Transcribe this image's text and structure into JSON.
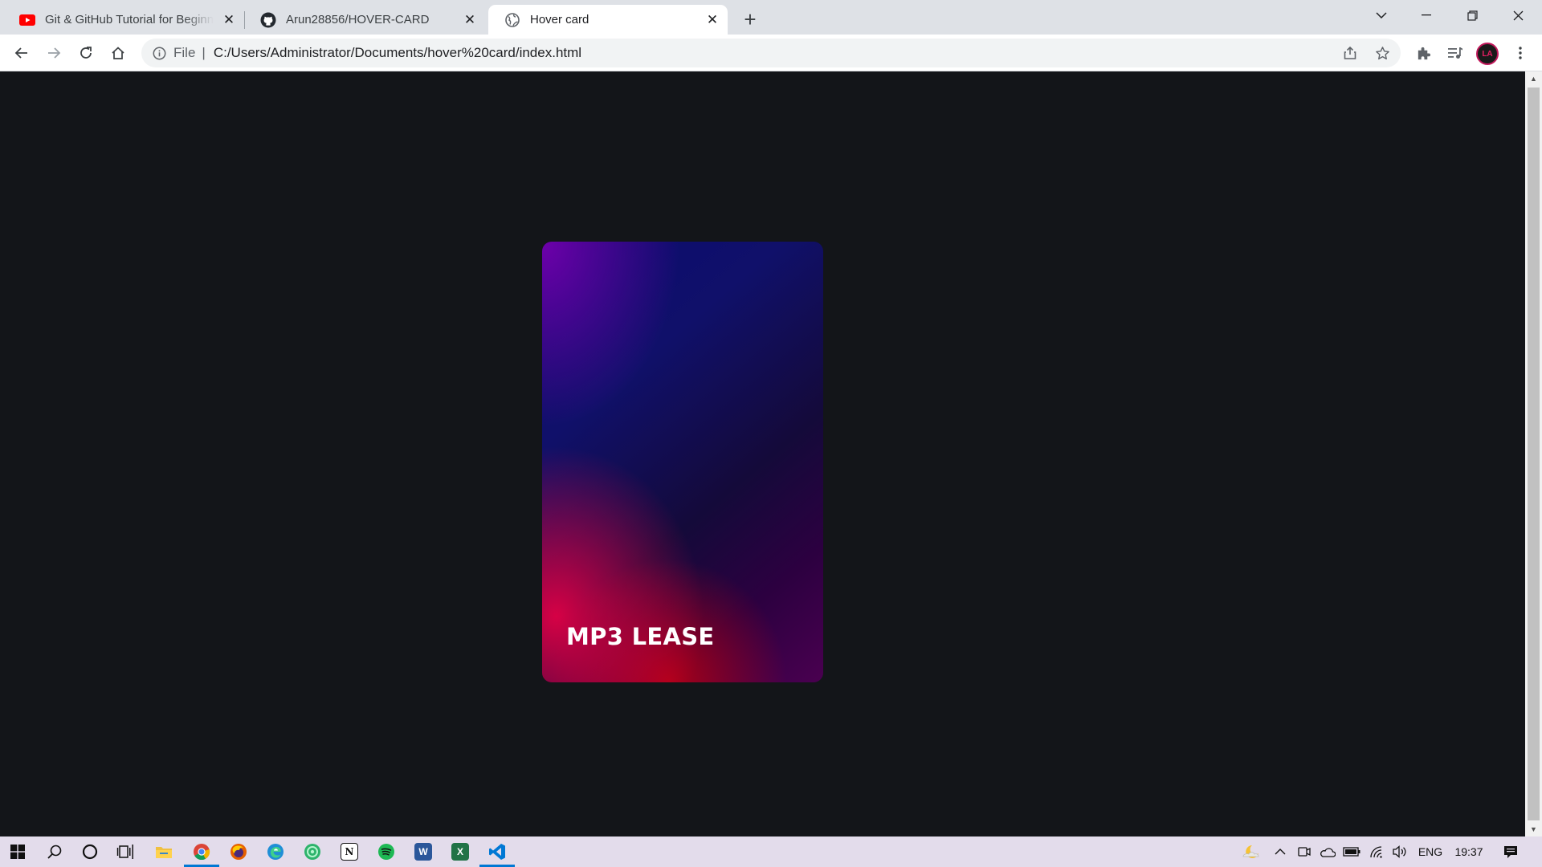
{
  "browser": {
    "tabs": [
      {
        "title": "Git & GitHub Tutorial for Beginners",
        "icon": "youtube-icon",
        "active": false
      },
      {
        "title": "Arun28856/HOVER-CARD",
        "icon": "github-icon",
        "active": false
      },
      {
        "title": "Hover card",
        "icon": "globe-icon",
        "active": true
      }
    ],
    "address": {
      "scheme_label": "File",
      "separator": "|",
      "url": "C:/Users/Administrator/Documents/hover%20card/index.html"
    },
    "avatar_initials": "LA"
  },
  "page": {
    "background": "#131519",
    "card": {
      "title": "MP3 LEASE",
      "colors": [
        "#6e00aa",
        "#0a0a70",
        "#eb0046",
        "#b40014",
        "#4a0050"
      ]
    }
  },
  "taskbar": {
    "apps": [
      "windows-start-icon",
      "search-icon",
      "cortana-icon",
      "task-view-icon",
      "file-explorer-icon",
      "chrome-icon",
      "firefox-icon",
      "edge-icon",
      "app-green-icon",
      "notion-icon",
      "spotify-icon",
      "word-icon",
      "excel-icon",
      "vscode-icon"
    ],
    "tray": {
      "language": "ENG",
      "time": "19:37"
    }
  }
}
